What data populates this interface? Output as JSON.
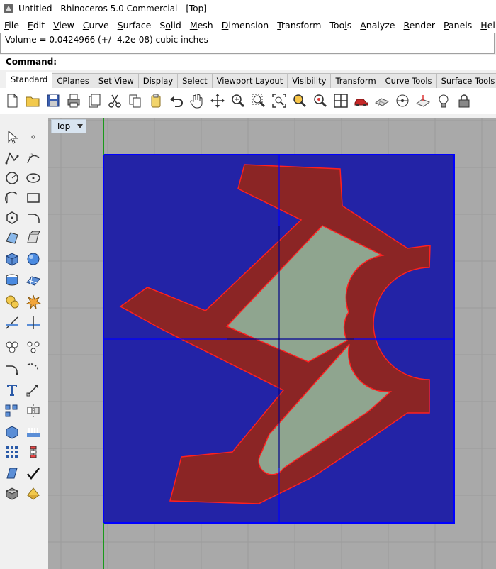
{
  "window": {
    "title": "Untitled - Rhinoceros 5.0 Commercial - [Top]"
  },
  "menubar": {
    "items": [
      {
        "label": "File",
        "accel": "F"
      },
      {
        "label": "Edit",
        "accel": "E"
      },
      {
        "label": "View",
        "accel": "V"
      },
      {
        "label": "Curve",
        "accel": "C"
      },
      {
        "label": "Surface",
        "accel": "S"
      },
      {
        "label": "Solid",
        "accel": "o"
      },
      {
        "label": "Mesh",
        "accel": "M"
      },
      {
        "label": "Dimension",
        "accel": "D"
      },
      {
        "label": "Transform",
        "accel": "T"
      },
      {
        "label": "Tools",
        "accel": "l"
      },
      {
        "label": "Analyze",
        "accel": "A"
      },
      {
        "label": "Render",
        "accel": "R"
      },
      {
        "label": "Panels",
        "accel": "P"
      },
      {
        "label": "Help",
        "accel": "H"
      }
    ]
  },
  "command": {
    "history": "Volume = 0.0424966 (+/- 4.2e-08) cubic inches",
    "prompt": "Command:"
  },
  "tabs": [
    "Standard",
    "CPlanes",
    "Set View",
    "Display",
    "Select",
    "Viewport Layout",
    "Visibility",
    "Transform",
    "Curve Tools",
    "Surface Tools"
  ],
  "active_tab": "Standard",
  "toolbar": {
    "icons": [
      "new-file-icon",
      "open-folder-icon",
      "save-icon",
      "print-icon",
      "import-icon",
      "cut-icon",
      "copy-icon",
      "paste-icon",
      "undo-icon",
      "pan-hand-icon",
      "rotate-view-icon",
      "zoom-icon",
      "zoom-window-icon",
      "zoom-extents-icon",
      "zoom-selected-icon",
      "zoom-target-icon",
      "four-viewports-icon",
      "car-render-icon",
      "grid-plane-icon",
      "cplane-origin-icon",
      "cplane-icon",
      "light-bulb-icon",
      "lock-icon"
    ]
  },
  "viewport": {
    "name": "Top",
    "colors": {
      "background": "#a9a9a9",
      "grid_line": "#9a9a9a",
      "grid_major": "#8c8c8c",
      "plate": "#2323a6",
      "plate_edge": "#0000ff",
      "part": "#8b2525",
      "part_edge": "#ff2020",
      "pocket": "#8fa58f"
    }
  }
}
